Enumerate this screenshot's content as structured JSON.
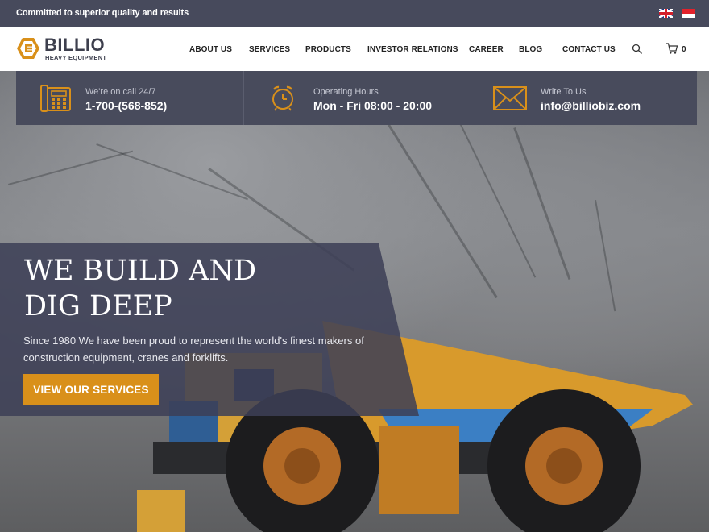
{
  "topbar": {
    "tagline": "Committed to superior quality and results",
    "languages": [
      {
        "name": "english-flag",
        "icon": "uk-flag-icon"
      },
      {
        "name": "indonesian-flag",
        "icon": "id-flag-icon"
      }
    ]
  },
  "brand": {
    "name": "BILLIO",
    "subtitle": "HEAVY EQUIPMENT",
    "accent": "#d9901a",
    "dark": "#474a5c"
  },
  "nav": {
    "items": [
      {
        "label": "ABOUT US"
      },
      {
        "label": "SERVICES"
      },
      {
        "label": "PRODUCTS"
      },
      {
        "label": "INVESTOR RELATIONS"
      },
      {
        "label": "CAREER"
      },
      {
        "label": "BLOG"
      },
      {
        "label": "CONTACT US"
      }
    ],
    "search_icon": "search-icon",
    "cart_icon": "cart-icon",
    "cart_count": "0"
  },
  "info": [
    {
      "icon": "phone-icon",
      "label": "We're on call 24/7",
      "value": "1-700-(568-852)"
    },
    {
      "icon": "alarm-clock-icon",
      "label": "Operating Hours",
      "value": "Mon - Fri 08:00 - 20:00"
    },
    {
      "icon": "envelope-icon",
      "label": "Write To Us",
      "value": "info@billiobiz.com"
    }
  ],
  "hero": {
    "title_line1": "WE BUILD AND",
    "title_line2": "DIG DEEP",
    "subtitle": "Since 1980 We have been proud to represent the world's finest makers of construction equipment, cranes and forklifts.",
    "cta": "VIEW OUR SERVICES"
  }
}
